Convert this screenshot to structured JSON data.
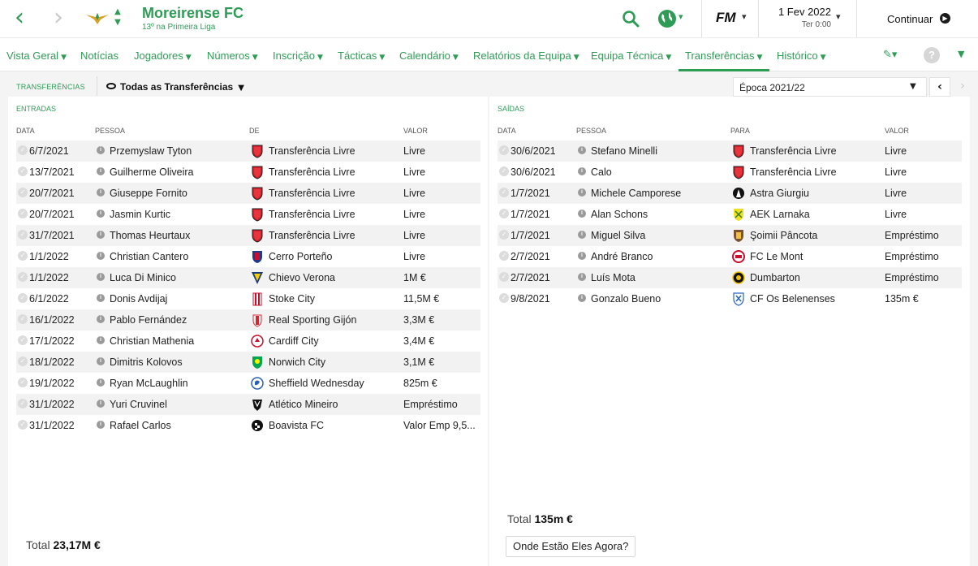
{
  "header": {
    "club_name": "Moreirense FC",
    "club_subtitle": "13º na Primeira Liga",
    "date": "1 Fev 2022",
    "time": "Ter 0:00",
    "game_logo": "FM",
    "continue_label": "Continuar"
  },
  "colors": {
    "accent": "#2e9c55",
    "background": "#f4f4f4",
    "panel": "#ffffff"
  },
  "nav": {
    "items": [
      {
        "label": "Vista Geral",
        "chev": true
      },
      {
        "label": "Notícias",
        "chev": false
      },
      {
        "label": "Jogadores",
        "chev": true
      },
      {
        "label": "Números",
        "chev": true
      },
      {
        "label": "Inscrição",
        "chev": true
      },
      {
        "label": "Tácticas",
        "chev": true
      },
      {
        "label": "Calendário",
        "chev": true
      },
      {
        "label": "Relatórios da Equipa",
        "chev": true
      },
      {
        "label": "Equipa Técnica",
        "chev": true
      },
      {
        "label": "Transferências",
        "chev": true,
        "active": true
      },
      {
        "label": "Histórico",
        "chev": true
      }
    ],
    "help_label": "?"
  },
  "toolbar": {
    "title": "TRANSFERÊNCIAS",
    "filter": "Todas as Transferências",
    "season": "Época 2021/22"
  },
  "incoming": {
    "heading": "ENTRADAS",
    "columns": {
      "date": "DATA",
      "person": "PESSOA",
      "club": "DE",
      "value": "VALOR"
    },
    "rows": [
      {
        "date": "6/7/2021",
        "person": "Przemyslaw Tyton",
        "club": "Transferência Livre",
        "value": "Livre",
        "badge": "free"
      },
      {
        "date": "13/7/2021",
        "person": "Guilherme Oliveira",
        "club": "Transferência Livre",
        "value": "Livre",
        "badge": "free"
      },
      {
        "date": "20/7/2021",
        "person": "Giuseppe Fornito",
        "club": "Transferência Livre",
        "value": "Livre",
        "badge": "free"
      },
      {
        "date": "20/7/2021",
        "person": "Jasmin Kurtic",
        "club": "Transferência Livre",
        "value": "Livre",
        "badge": "free"
      },
      {
        "date": "31/7/2021",
        "person": "Thomas Heurtaux",
        "club": "Transferência Livre",
        "value": "Livre",
        "badge": "free"
      },
      {
        "date": "1/1/2022",
        "person": "Christian Cantero",
        "club": "Cerro Porteño",
        "value": "Livre",
        "badge": "cerro"
      },
      {
        "date": "1/1/2022",
        "person": "Luca Di Minico",
        "club": "Chievo Verona",
        "value": "1M €",
        "badge": "chievo"
      },
      {
        "date": "6/1/2022",
        "person": "Donis Avdijaj",
        "club": "Stoke City",
        "value": "11,5M €",
        "badge": "stoke"
      },
      {
        "date": "16/1/2022",
        "person": "Pablo Fernández",
        "club": "Real Sporting Gijón",
        "value": "3,3M €",
        "badge": "sporting"
      },
      {
        "date": "17/1/2022",
        "person": "Christian Mathenia",
        "club": "Cardiff City",
        "value": "3,4M €",
        "badge": "cardiff"
      },
      {
        "date": "18/1/2022",
        "person": "Dimitris Kolovos",
        "club": "Norwich City",
        "value": "3,1M €",
        "badge": "norwich"
      },
      {
        "date": "19/1/2022",
        "person": "Ryan McLaughlin",
        "club": "Sheffield Wednesday",
        "value": "825m €",
        "badge": "sheffield"
      },
      {
        "date": "31/1/2022",
        "person": "Yuri Cruvinel",
        "club": "Atlético Mineiro",
        "value": "Empréstimo",
        "badge": "mineiro"
      },
      {
        "date": "31/1/2022",
        "person": "Rafael Carlos",
        "club": "Boavista FC",
        "value": "Valor Emp 9,5...",
        "badge": "boavista"
      }
    ],
    "total_label": "Total",
    "total_value": "23,17M €"
  },
  "outgoing": {
    "heading": "SAÍDAS",
    "columns": {
      "date": "DATA",
      "person": "PESSOA",
      "club": "PARA",
      "value": "VALOR"
    },
    "rows": [
      {
        "date": "30/6/2021",
        "person": "Stefano Minelli",
        "club": "Transferência Livre",
        "value": "Livre",
        "badge": "free"
      },
      {
        "date": "30/6/2021",
        "person": "Calo",
        "club": "Transferência Livre",
        "value": "Livre",
        "badge": "free"
      },
      {
        "date": "1/7/2021",
        "person": "Michele Camporese",
        "club": "Astra Giurgiu",
        "value": "Livre",
        "badge": "astra"
      },
      {
        "date": "1/7/2021",
        "person": "Alan Schons",
        "club": "AEK Larnaka",
        "value": "Livre",
        "badge": "aek"
      },
      {
        "date": "1/7/2021",
        "person": "Miguel Silva",
        "club": "Şoimii Pâncota",
        "value": "Empréstimo",
        "badge": "soimii"
      },
      {
        "date": "2/7/2021",
        "person": "André Branco",
        "club": "FC Le Mont",
        "value": "Empréstimo",
        "badge": "lemont"
      },
      {
        "date": "2/7/2021",
        "person": "Luís Mota",
        "club": "Dumbarton",
        "value": "Empréstimo",
        "badge": "dumbarton"
      },
      {
        "date": "9/8/2021",
        "person": "Gonzalo Bueno",
        "club": "CF Os Belenenses",
        "value": "135m €",
        "badge": "belenenses"
      }
    ],
    "total_label": "Total",
    "total_value": "135m €",
    "where_button": "Onde Estão Eles Agora?"
  }
}
